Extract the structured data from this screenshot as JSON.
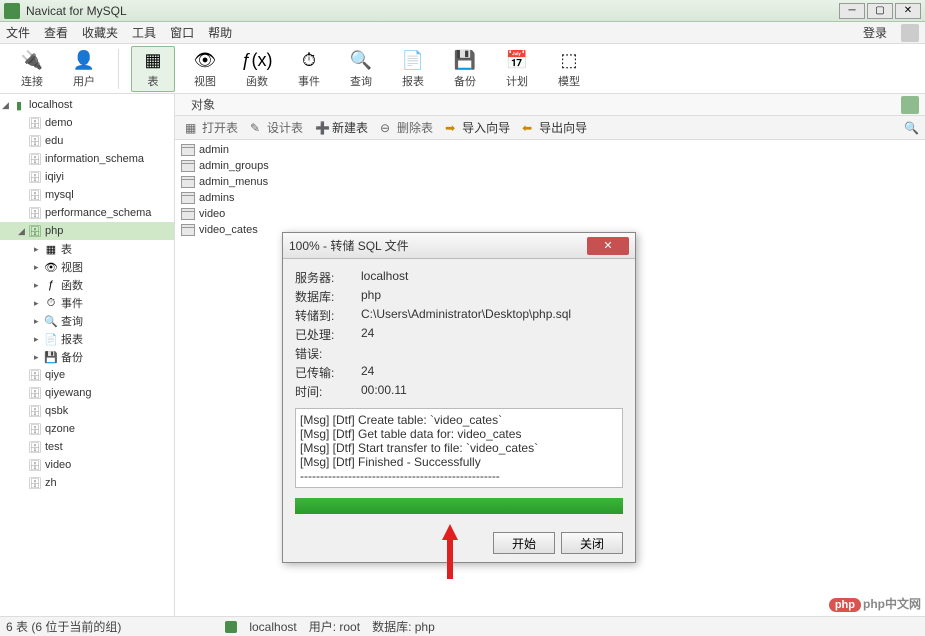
{
  "app_title": "Navicat for MySQL",
  "menu": [
    "文件",
    "查看",
    "收藏夹",
    "工具",
    "窗口",
    "帮助"
  ],
  "login_label": "登录",
  "toolbar": [
    {
      "label": "连接",
      "icon": "🔌",
      "active": false
    },
    {
      "label": "用户",
      "icon": "👤",
      "active": false
    },
    {
      "sep": true
    },
    {
      "label": "表",
      "icon": "▦",
      "active": true
    },
    {
      "label": "视图",
      "icon": "👁",
      "active": false
    },
    {
      "label": "函数",
      "icon": "ƒ(x)",
      "active": false
    },
    {
      "label": "事件",
      "icon": "⏱",
      "active": false
    },
    {
      "label": "查询",
      "icon": "🔍",
      "active": false
    },
    {
      "label": "报表",
      "icon": "📄",
      "active": false
    },
    {
      "label": "备份",
      "icon": "💾",
      "active": false
    },
    {
      "label": "计划",
      "icon": "📅",
      "active": false
    },
    {
      "label": "模型",
      "icon": "⬚",
      "active": false
    }
  ],
  "connection": "localhost",
  "databases": [
    "demo",
    "edu",
    "information_schema",
    "iqiyi",
    "mysql",
    "performance_schema"
  ],
  "selected_db": "php",
  "db_children": [
    {
      "label": "表",
      "icon": "▦"
    },
    {
      "label": "视图",
      "icon": "👁"
    },
    {
      "label": "函数",
      "icon": "ƒ"
    },
    {
      "label": "事件",
      "icon": "⏱"
    },
    {
      "label": "查询",
      "icon": "🔍"
    },
    {
      "label": "报表",
      "icon": "📄"
    },
    {
      "label": "备份",
      "icon": "💾"
    }
  ],
  "databases_after": [
    "qiye",
    "qiyewang",
    "qsbk",
    "qzone",
    "test",
    "video",
    "zh"
  ],
  "object_tab": "对象",
  "sub_toolbar": {
    "open": "打开表",
    "design": "设计表",
    "create": "新建表",
    "delete": "删除表",
    "import": "导入向导",
    "export": "导出向导"
  },
  "tables": [
    "admin",
    "admin_groups",
    "admin_menus",
    "admins",
    "video",
    "video_cates"
  ],
  "dialog": {
    "title": "100% - 转储 SQL 文件",
    "rows": {
      "server_k": "服务器:",
      "server_v": "localhost",
      "db_k": "数据库:",
      "db_v": "php",
      "path_k": "转储到:",
      "path_v": "C:\\Users\\Administrator\\Desktop\\php.sql",
      "processed_k": "已处理:",
      "processed_v": "24",
      "error_k": "错误:",
      "transferred_k": "已传输:",
      "transferred_v": "24",
      "time_k": "时间:",
      "time_v": "00:00.11"
    },
    "log": [
      "[Msg] [Dtf] Create table: `video_cates`",
      "[Msg] [Dtf] Get table data for: video_cates",
      "[Msg] [Dtf] Start transfer to file: `video_cates`",
      "[Msg] [Dtf] Finished - Successfully",
      "--------------------------------------------------"
    ],
    "start_btn": "开始",
    "close_btn": "关闭"
  },
  "statusbar": {
    "count": "6 表 (6 位于当前的组)",
    "conn": "localhost",
    "user": "用户: root",
    "db": "数据库: php"
  },
  "watermark": "php中文网"
}
